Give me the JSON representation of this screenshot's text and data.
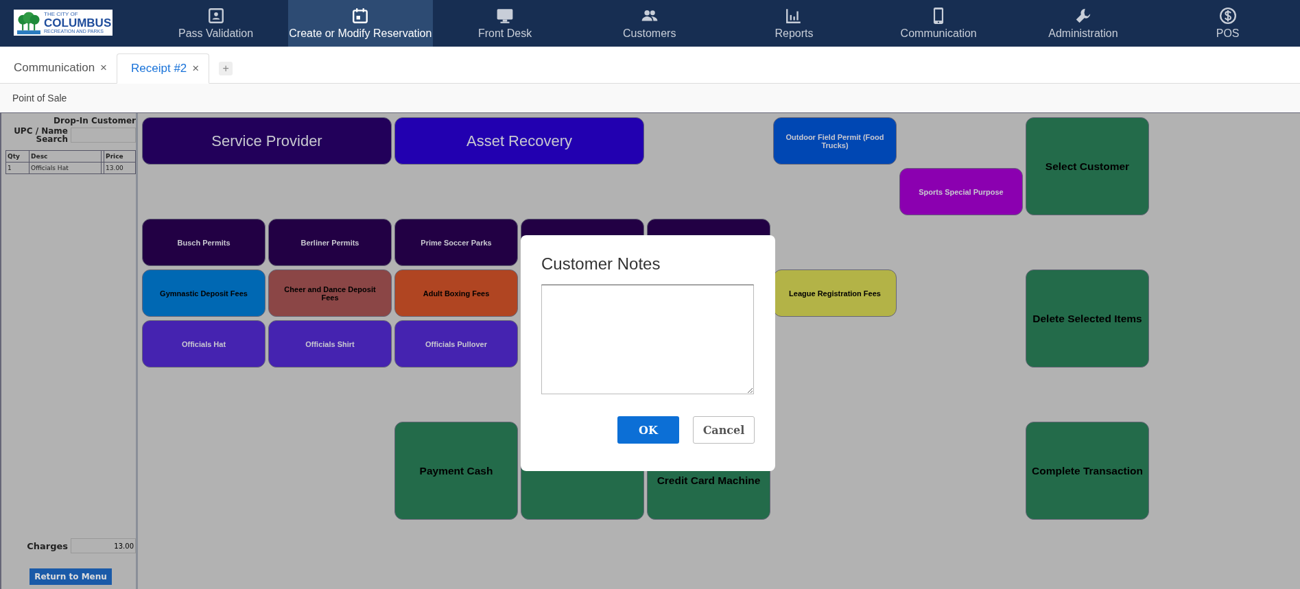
{
  "logo": {
    "lines": [
      "THE CITY OF",
      "COLUMBUS",
      "RECREATION AND PARKS"
    ]
  },
  "nav": [
    {
      "label": "Pass Validation",
      "selected": false
    },
    {
      "label": "Create or Modify Reservation",
      "selected": true
    },
    {
      "label": "Front Desk",
      "selected": false
    },
    {
      "label": "Customers",
      "selected": false
    },
    {
      "label": "Reports",
      "selected": false
    },
    {
      "label": "Communication",
      "selected": false
    },
    {
      "label": "Administration",
      "selected": false
    },
    {
      "label": "POS",
      "selected": false
    }
  ],
  "tabs": [
    {
      "label": "Communication",
      "close": "×",
      "selected": false
    },
    {
      "label": "Receipt #2",
      "close": "×",
      "selected": true
    }
  ],
  "add_tab": "+",
  "breadcrumb": "Point of Sale",
  "sidebar": {
    "customer": "Drop-In Customer",
    "search_label": "UPC / Name Search",
    "table": {
      "columns": [
        "Qty",
        "Desc",
        "",
        "Price"
      ],
      "rows": [
        [
          "1",
          "Officials Hat",
          "",
          "13.00"
        ]
      ]
    },
    "charges_label": "Charges",
    "charges_value": "13.00",
    "return_button": "Return to Menu"
  },
  "buttons": [
    {
      "label": "Service Provider",
      "kind": "large",
      "color": "#22005a"
    },
    {
      "label": "Asset Recovery",
      "kind": "large",
      "color": "#2200b0"
    },
    {
      "label": "Outdoor Field Permit (Food Trucks)",
      "kind": "small",
      "color": "#0047b3"
    },
    {
      "label": "Sports Special Purpose",
      "kind": "small",
      "color": "#8b00b0"
    },
    {
      "label": "Select Customer",
      "kind": "action",
      "color": "#236b4a"
    },
    {
      "label": "Busch Permits",
      "kind": "small",
      "color": "#220044"
    },
    {
      "label": "Berliner Permits",
      "kind": "small",
      "color": "#220044"
    },
    {
      "label": "Prime Soccer Parks",
      "kind": "small",
      "color": "#220044"
    },
    {
      "kind": "small",
      "color": "#220044"
    },
    {
      "kind": "small",
      "color": "#220044"
    },
    {
      "label": "Gymnastic Deposit Fees",
      "kind": "fee",
      "color": "#0068b3"
    },
    {
      "label": "Cheer and Dance Deposit Fees",
      "kind": "fee",
      "color": "#8b4646"
    },
    {
      "label": "Adult Boxing Fees",
      "kind": "fee",
      "color": "#b04522"
    },
    {
      "label": "League Registration Fees",
      "kind": "fee",
      "color": "#b3b347"
    },
    {
      "label": "Delete Selected Items",
      "kind": "action",
      "color": "#236b4a"
    },
    {
      "label": "Officials Hat",
      "kind": "small",
      "color": "#4523b0"
    },
    {
      "label": "Officials Shirt",
      "kind": "small",
      "color": "#4523b0"
    },
    {
      "label": "Officials Pullover",
      "kind": "small",
      "color": "#4523b0"
    },
    {
      "label": "Payment Cash",
      "kind": "action",
      "color": "#236b4a"
    },
    {
      "kind": "action",
      "color": "#236b4a"
    },
    {
      "label": "Credit Card Machine",
      "kind": "action-low",
      "color": "#236b4a"
    },
    {
      "label": "Complete Transaction",
      "kind": "action",
      "color": "#236b4a"
    }
  ],
  "dialog": {
    "title": "Customer Notes",
    "ok": "OK",
    "cancel": "Cancel"
  }
}
